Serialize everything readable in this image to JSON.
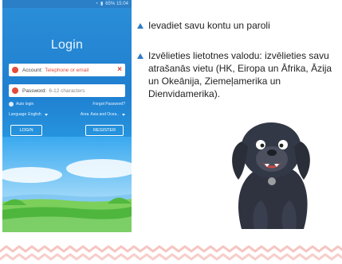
{
  "phone": {
    "status": {
      "right_text": "65% 15:04"
    },
    "title": "Login",
    "account": {
      "label": "Account:",
      "value": "Telephone or email"
    },
    "password": {
      "label": "Password:",
      "placeholder": "6-12 characters"
    },
    "auto_login_label": "Auto login",
    "forgot_label": "Forgot Password?",
    "language_label": "Language",
    "language_value": "English",
    "area_label": "Area",
    "area_value": "Asia and Ocea..",
    "login_button": "LOGIN",
    "register_button": "REGISTER"
  },
  "instructions": [
    {
      "text": "Ievadiet savu kontu un paroli"
    },
    {
      "text": "Izvēlieties lietotnes valodu: izvēlieties savu atrašanās vietu (HK, Eiropa un Āfrika, Āzija un Okeānija, Ziemeļamerika un Dienvidamerika)."
    }
  ],
  "colors": {
    "accent": "#2e7bc4",
    "error": "#e24130",
    "border_pink": "#f6c6c2"
  },
  "icons": {
    "bullet": "triangle-up-icon",
    "account": "user-icon",
    "password": "lock-icon",
    "clear": "close-icon"
  }
}
